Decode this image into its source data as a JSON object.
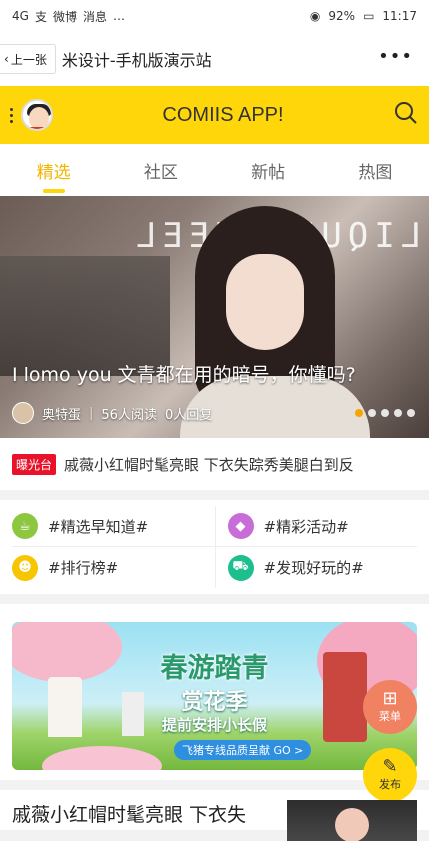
{
  "status_bar": {
    "signal": "4G",
    "notif_icons": [
      "支",
      "微博",
      "消息",
      "…"
    ],
    "battery": "92%",
    "time": "11:17"
  },
  "title_bar": {
    "back_label": "上一张",
    "title": "米设计-手机版演示站",
    "more_label": "•••"
  },
  "app_bar": {
    "title": "COMIIS APP!"
  },
  "tabs": [
    {
      "label": "精选",
      "active": true
    },
    {
      "label": "社区",
      "active": false
    },
    {
      "label": "新帖",
      "active": false
    },
    {
      "label": "热图",
      "active": false
    }
  ],
  "banner": {
    "sign_text": "LIQUID FEEL",
    "caption": "I lomo you 文青都在用的暗号，你懂吗?",
    "author": "奥特蛋",
    "views": "56人阅读",
    "replies": "0人回复",
    "page_count": 5,
    "active_page": 0
  },
  "ticker": {
    "tag": "曝光台",
    "text": "戚薇小红帽时髦亮眼 下衣失踪秀美腿白到反"
  },
  "shortcuts": [
    {
      "label": "#精选早知道#",
      "icon": "coffee-icon",
      "color": "#8dc63f"
    },
    {
      "label": "#精彩活动#",
      "icon": "diamond-icon",
      "color": "#c86dd7"
    },
    {
      "label": "#排行榜#",
      "icon": "sunglasses-icon",
      "color": "#f7c600"
    },
    {
      "label": "#发现好玩的#",
      "icon": "cart-icon",
      "color": "#1dbf8e"
    }
  ],
  "ad": {
    "headline": "春游踏青",
    "subheadline": "赏花季",
    "tagline": "提前安排小长假",
    "cta": "飞猪专线品质呈献 GO >"
  },
  "fabs": {
    "menu_label": "菜单",
    "post_label": "发布"
  },
  "article": {
    "title": "戚薇小红帽时髦亮眼 下衣失"
  },
  "colors": {
    "brand_yellow": "#ffd60a",
    "tab_active": "#f2b400",
    "ticker_tag": "#e8132b",
    "menu_fab": "#f08262"
  }
}
